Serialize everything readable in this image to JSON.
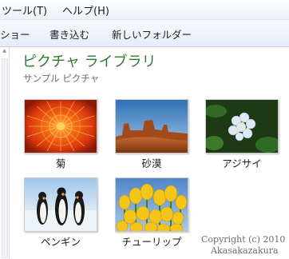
{
  "menubar": {
    "items": [
      {
        "label": "ツール(T)"
      },
      {
        "label": "ヘルプ(H)"
      }
    ]
  },
  "toolbar": {
    "items": [
      {
        "label": "ショー"
      },
      {
        "label": "書き込む"
      },
      {
        "label": "新しいフォルダー"
      }
    ]
  },
  "library": {
    "title": "ピクチャ ライブラリ",
    "subtitle": "サンプル ピクチャ"
  },
  "pictures": [
    {
      "name": "菊",
      "icon": "chrysanthemum-thumbnail"
    },
    {
      "name": "砂漠",
      "icon": "desert-thumbnail"
    },
    {
      "name": "アジサイ",
      "icon": "hydrangea-thumbnail"
    },
    {
      "name": "ペンギン",
      "icon": "penguins-thumbnail"
    },
    {
      "name": "チューリップ",
      "icon": "tulips-thumbnail"
    }
  ],
  "watermark": {
    "line1": "Copyright (c) 2010",
    "line2": "Akasakazakura"
  },
  "colors": {
    "title_green": "#2b7c2b",
    "toolbar_blue": "#e4ecf6"
  }
}
